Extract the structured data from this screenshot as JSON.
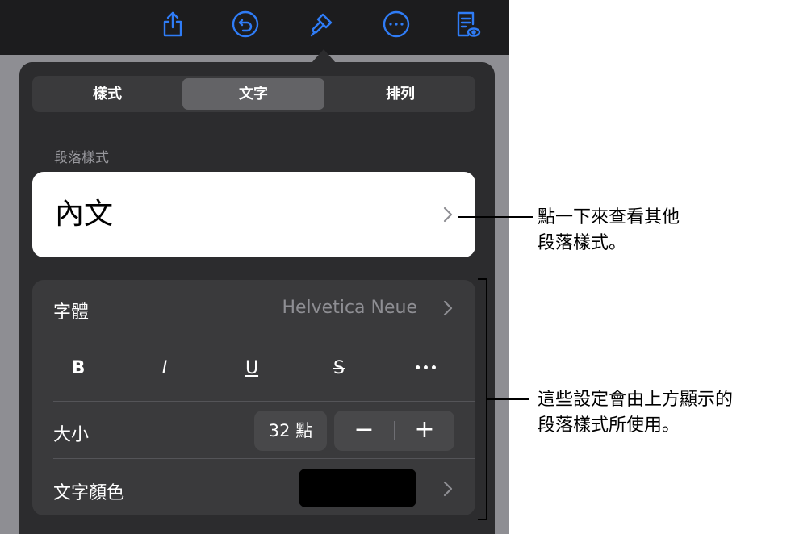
{
  "toolbar": {
    "icons": [
      "share-icon",
      "undo-icon",
      "format-brush-icon",
      "more-icon",
      "reader-view-icon"
    ]
  },
  "tabs": [
    {
      "label": "樣式",
      "active": false
    },
    {
      "label": "文字",
      "active": true
    },
    {
      "label": "排列",
      "active": false
    }
  ],
  "paragraph_style": {
    "section_label": "段落樣式",
    "current": "內文"
  },
  "font": {
    "label": "字體",
    "value": "Helvetica Neue"
  },
  "format_buttons": [
    "B",
    "I",
    "U",
    "S",
    "•••"
  ],
  "size": {
    "label": "大小",
    "value": "32 點",
    "decrement": "−",
    "increment": "+"
  },
  "text_color": {
    "label": "文字顏色",
    "swatch": "#000000"
  },
  "callouts": {
    "style_line1": "點一下來查看其他",
    "style_line2": "段落樣式。",
    "settings_line1": "這些設定會由上方顯示的",
    "settings_line2": "段落樣式所使用。"
  },
  "colors": {
    "toolbar_icon": "#2f7cf6",
    "panel": "#2c2c2e",
    "card": "#3a3a3c"
  }
}
